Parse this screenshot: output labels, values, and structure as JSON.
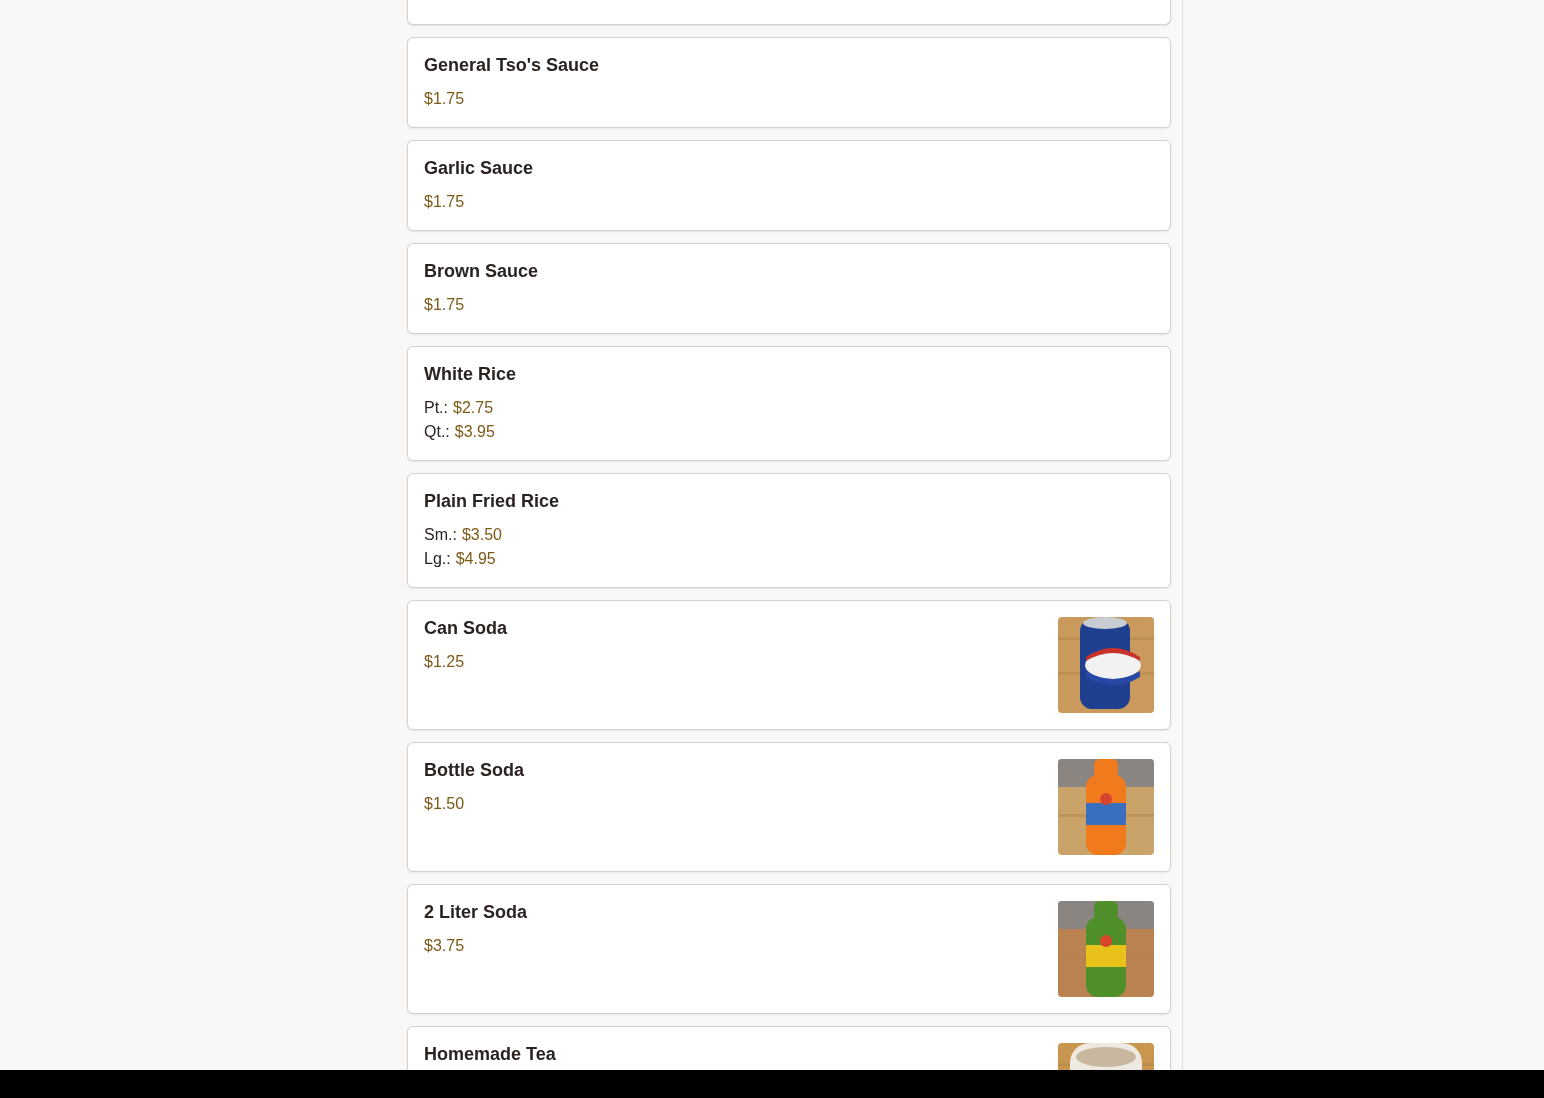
{
  "items": [
    {
      "name": "General Tso's Sauce",
      "prices": [
        {
          "value": "$1.75"
        }
      ]
    },
    {
      "name": "Garlic Sauce",
      "prices": [
        {
          "value": "$1.75"
        }
      ]
    },
    {
      "name": "Brown Sauce",
      "prices": [
        {
          "value": "$1.75"
        }
      ]
    },
    {
      "name": "White Rice",
      "prices": [
        {
          "label": "Pt.:",
          "value": "$2.75"
        },
        {
          "label": "Qt.:",
          "value": "$3.95"
        }
      ]
    },
    {
      "name": "Plain Fried Rice",
      "prices": [
        {
          "label": "Sm.:",
          "value": "$3.50"
        },
        {
          "label": "Lg.:",
          "value": "$4.95"
        }
      ]
    },
    {
      "name": "Can Soda",
      "prices": [
        {
          "value": "$1.25"
        }
      ],
      "image": {
        "kind": "picture"
      }
    },
    {
      "name": "Bottle Soda",
      "prices": [
        {
          "value": "$1.50"
        }
      ],
      "image": {
        "kind": "picture"
      }
    },
    {
      "name": "2 Liter Soda",
      "prices": [
        {
          "value": "$3.75"
        }
      ],
      "image": {
        "kind": "picture"
      }
    },
    {
      "name": "Homemade Tea",
      "image": {
        "kind": "picture"
      }
    }
  ]
}
